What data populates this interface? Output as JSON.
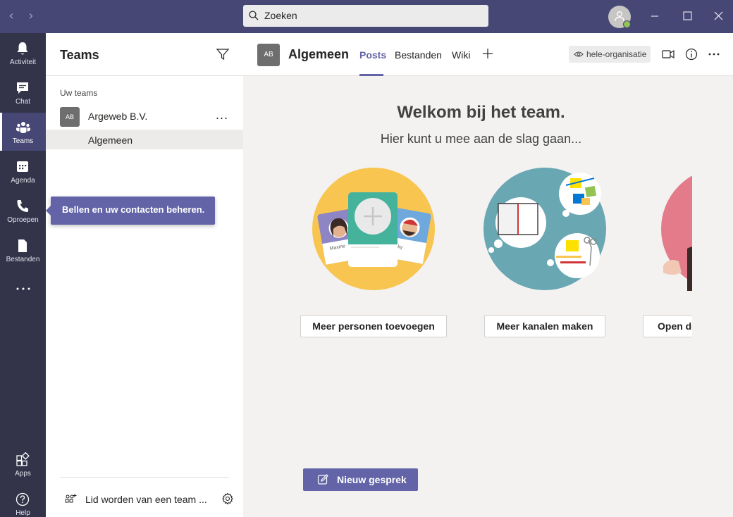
{
  "titlebar": {
    "back_icon": "chevron-left-icon",
    "forward_icon": "chevron-right-icon",
    "search_placeholder": "Zoeken",
    "presence_color": "#92c353",
    "window_controls": [
      "minimize-icon",
      "maximize-icon",
      "close-icon"
    ]
  },
  "rail": {
    "items": [
      {
        "label": "Activiteit",
        "icon": "bell-icon"
      },
      {
        "label": "Chat",
        "icon": "chat-icon"
      },
      {
        "label": "Teams",
        "icon": "teams-icon",
        "active": true
      },
      {
        "label": "Agenda",
        "icon": "calendar-icon"
      },
      {
        "label": "Oproepen",
        "icon": "phone-icon"
      },
      {
        "label": "Bestanden",
        "icon": "file-icon"
      }
    ],
    "more_icon": "ellipsis-icon",
    "apps_label": "Apps",
    "help_label": "Help"
  },
  "panel": {
    "title": "Teams",
    "section_label": "Uw teams",
    "team": {
      "avatar": "AB",
      "name": "Argeweb B.V.",
      "more": "..."
    },
    "channel": {
      "name": "Algemeen"
    },
    "join_label": "Lid worden van een team ...",
    "settings_icon": "gear-icon"
  },
  "tooltip": {
    "text": "Bellen en uw contacten beheren."
  },
  "channel_header": {
    "avatar": "AB",
    "title": "Algemeen",
    "tabs": [
      "Posts",
      "Bestanden",
      "Wiki"
    ],
    "active_tab": "Posts",
    "org_label": "hele-organisatie"
  },
  "main": {
    "welcome": "Welkom bij het team.",
    "subtitle": "Hier kunt u mee aan de slag gaan...",
    "card_names": {
      "left": "Maxine",
      "right": "ky"
    },
    "actions": [
      "Meer personen toevoegen",
      "Meer kanalen maken",
      "Open de"
    ],
    "new_post_label": "Nieuw gesprek"
  },
  "colors": {
    "accent": "#6264a7",
    "titlebar": "#464775",
    "rail": "#33344a",
    "illus_yellow": "#f8c550",
    "illus_teal": "#69a7b3",
    "illus_pink": "#e47b8a"
  }
}
